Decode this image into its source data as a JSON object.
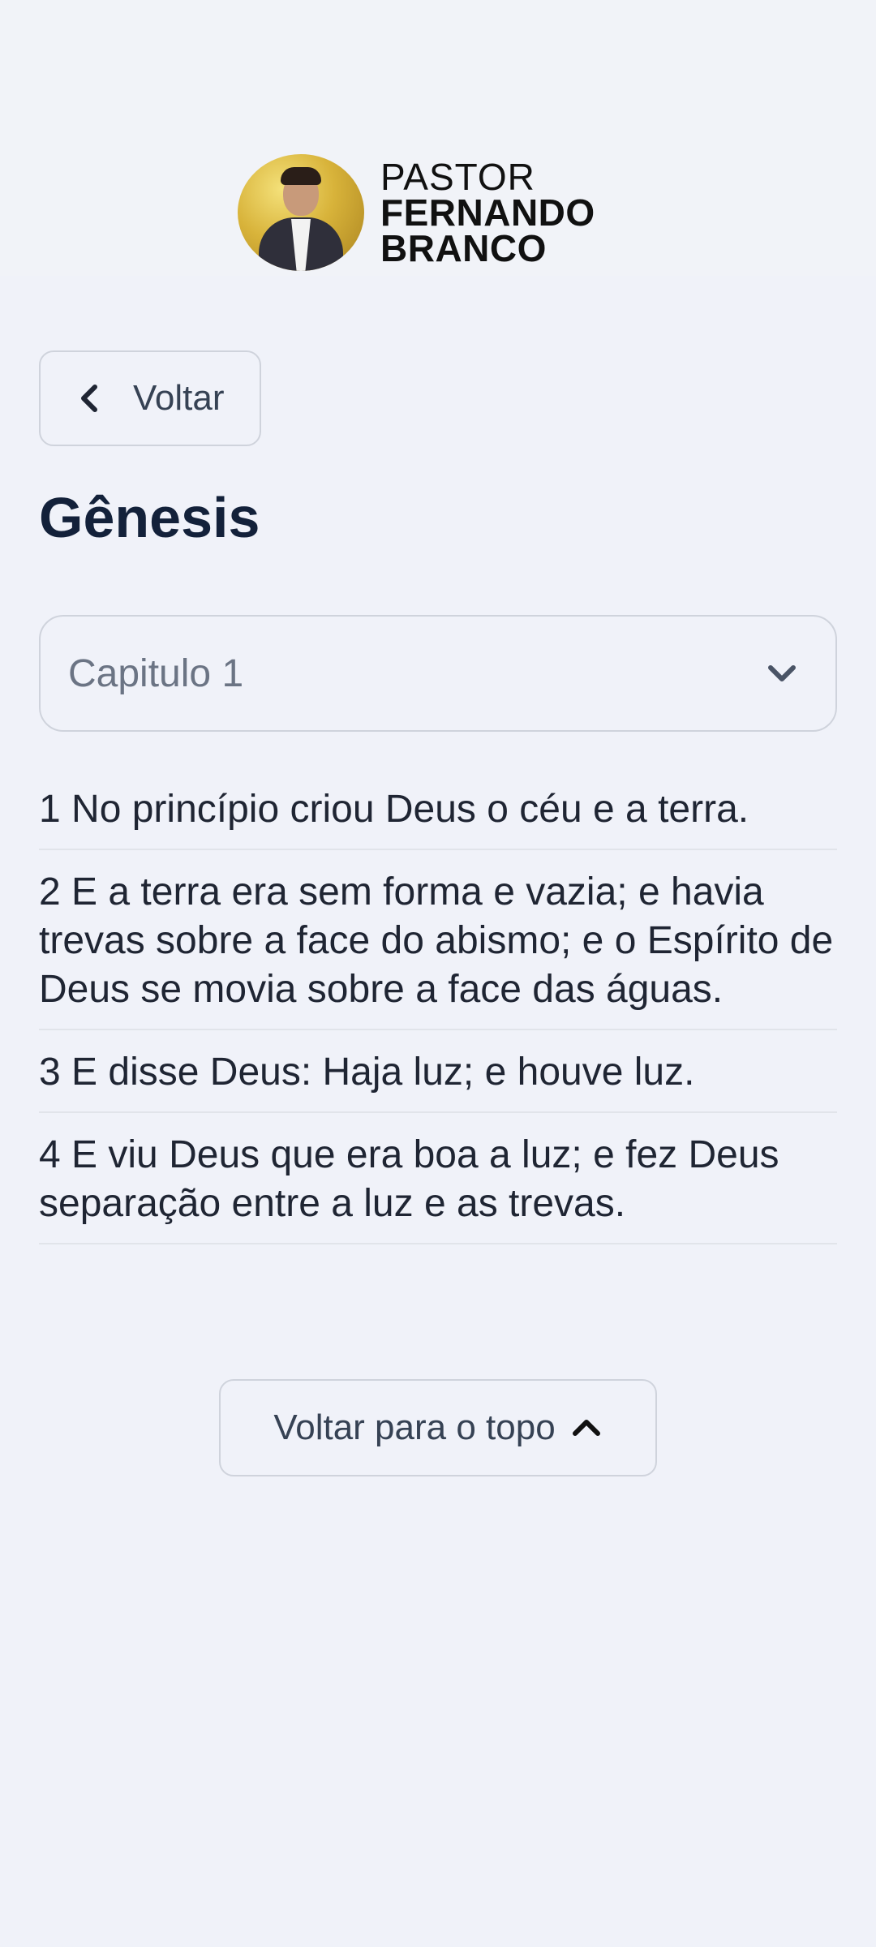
{
  "header": {
    "brand_line1": "PASTOR",
    "brand_line2": "FERNANDO",
    "brand_line3": "BRANCO"
  },
  "nav": {
    "back_label": "Voltar"
  },
  "book": {
    "title": "Gênesis"
  },
  "chapter_select": {
    "selected": "Capitulo 1"
  },
  "verses": [
    "1 No princípio criou Deus o céu e a terra.",
    "2  E a terra era sem forma e vazia; e havia trevas sobre a face do abismo; e o Espírito de Deus se movia sobre a face das águas.",
    "3 E disse Deus: Haja luz; e houve luz.",
    "4 E viu Deus que era boa a luz; e fez Deus separação entre a luz e as trevas."
  ],
  "footer": {
    "back_to_top_label": "Voltar para o topo"
  },
  "icons": {
    "back": "chevron-left-icon",
    "select": "chevron-down-icon",
    "top": "chevron-up-icon"
  }
}
